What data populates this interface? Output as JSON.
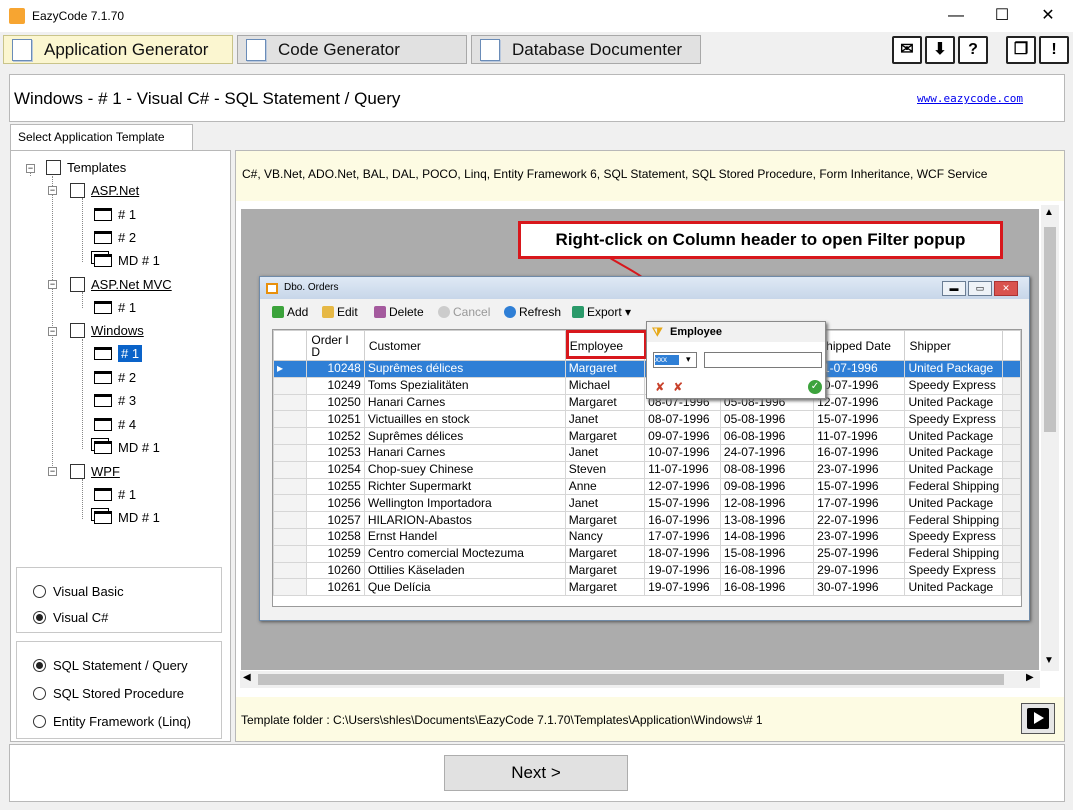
{
  "window": {
    "title": "EazyCode 7.1.70",
    "minimize": "—",
    "maximize": "☐",
    "close": "✕"
  },
  "tabs": [
    {
      "label": "Application Generator"
    },
    {
      "label": "Code Generator"
    },
    {
      "label": "Database Documenter"
    }
  ],
  "header": {
    "title": "Windows - # 1 - Visual C# - SQL Statement / Query",
    "link": "www.eazycode.com"
  },
  "template_tab": "Select Application Template",
  "tree": {
    "root": "Templates",
    "aspnet": "ASP.Net",
    "aspnet_1": "# 1",
    "aspnet_2": "# 2",
    "aspnet_md": "MD # 1",
    "mvc": "ASP.Net MVC",
    "mvc_1": "# 1",
    "windows": "Windows",
    "win_1": "# 1",
    "win_2": "# 2",
    "win_3": "# 3",
    "win_4": "# 4",
    "win_md": "MD # 1",
    "wpf": "WPF",
    "wpf_1": "# 1",
    "wpf_md": "MD # 1"
  },
  "language": {
    "vb": "Visual Basic",
    "cs": "Visual C#",
    "selected": "Visual C#"
  },
  "datasource": {
    "sql": "SQL Statement / Query",
    "sp": "SQL Stored Procedure",
    "ef": "Entity Framework (Linq)",
    "selected": "SQL Statement / Query"
  },
  "description": "C#, VB.Net, ADO.Net, BAL, DAL, POCO, Linq, Entity Framework 6, SQL Statement, SQL Stored Procedure, Form Inheritance, WCF Service",
  "preview": {
    "callout": "Right-click on Column header to open Filter popup",
    "window_title": "Dbo. Orders",
    "toolbar": {
      "add": "Add",
      "edit": "Edit",
      "delete": "Delete",
      "cancel": "Cancel",
      "refresh": "Refresh",
      "export": "Export"
    },
    "columns": {
      "order_id": "Order I D",
      "customer": "Customer",
      "employee": "Employee",
      "shipped": "Shipped Date",
      "shipper": "Shipper"
    },
    "filter": {
      "title": "Employee",
      "op": "xxx"
    },
    "rows": [
      [
        "10248",
        "Suprêmes délices",
        "Margaret",
        "",
        "",
        "11-07-1996",
        "United Package"
      ],
      [
        "10249",
        "Toms Spezialitäten",
        "Michael",
        "",
        "",
        "10-07-1996",
        "Speedy Express"
      ],
      [
        "10250",
        "Hanari Carnes",
        "Margaret",
        "08-07-1996",
        "05-08-1996",
        "12-07-1996",
        "United Package"
      ],
      [
        "10251",
        "Victuailles en stock",
        "Janet",
        "08-07-1996",
        "05-08-1996",
        "15-07-1996",
        "Speedy Express"
      ],
      [
        "10252",
        "Suprêmes délices",
        "Margaret",
        "09-07-1996",
        "06-08-1996",
        "11-07-1996",
        "United Package"
      ],
      [
        "10253",
        "Hanari Carnes",
        "Janet",
        "10-07-1996",
        "24-07-1996",
        "16-07-1996",
        "United Package"
      ],
      [
        "10254",
        "Chop-suey Chinese",
        "Steven",
        "11-07-1996",
        "08-08-1996",
        "23-07-1996",
        "United Package"
      ],
      [
        "10255",
        "Richter Supermarkt",
        "Anne",
        "12-07-1996",
        "09-08-1996",
        "15-07-1996",
        "Federal Shipping"
      ],
      [
        "10256",
        "Wellington Importadora",
        "Janet",
        "15-07-1996",
        "12-08-1996",
        "17-07-1996",
        "United Package"
      ],
      [
        "10257",
        "HILARION-Abastos",
        "Margaret",
        "16-07-1996",
        "13-08-1996",
        "22-07-1996",
        "Federal Shipping"
      ],
      [
        "10258",
        "Ernst Handel",
        "Nancy",
        "17-07-1996",
        "14-08-1996",
        "23-07-1996",
        "Speedy Express"
      ],
      [
        "10259",
        "Centro comercial Moctezuma",
        "Margaret",
        "18-07-1996",
        "15-08-1996",
        "25-07-1996",
        "Federal Shipping"
      ],
      [
        "10260",
        "Ottilies Käseladen",
        "Margaret",
        "19-07-1996",
        "16-08-1996",
        "29-07-1996",
        "Speedy Express"
      ],
      [
        "10261",
        "Que Delícia",
        "Margaret",
        "19-07-1996",
        "16-08-1996",
        "30-07-1996",
        "United Package"
      ]
    ]
  },
  "folder": "Template folder : C:\\Users\\shles\\Documents\\EazyCode 7.1.70\\Templates\\Application\\Windows\\# 1",
  "next": "Next >"
}
